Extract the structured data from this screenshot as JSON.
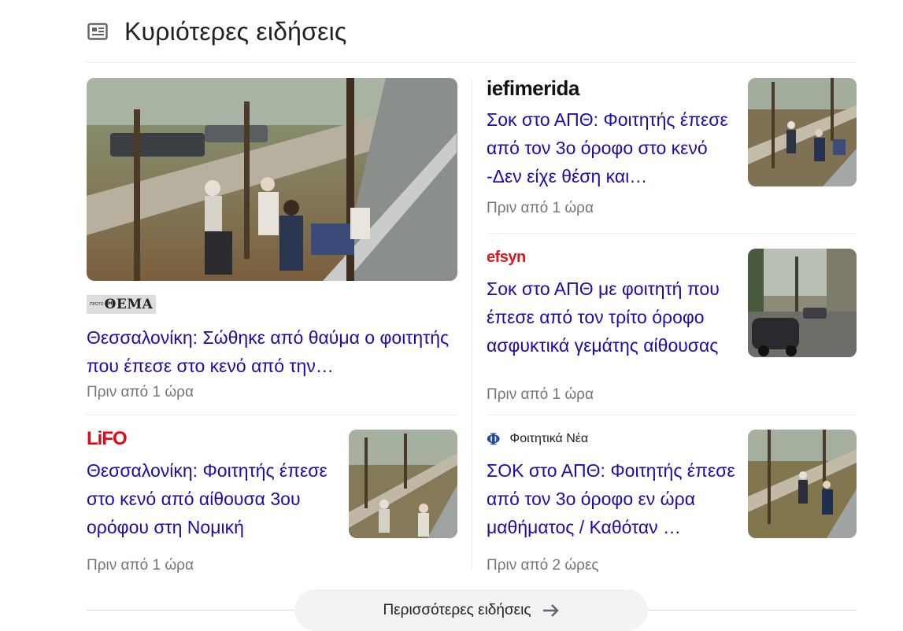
{
  "header": {
    "icon": "newspaper-icon",
    "title": "Κυριότερες ειδήσεις"
  },
  "featured": {
    "source": "ΘΕΜΑ",
    "source_prefix": "ΠΡΩΤΟ",
    "headline": "Θεσσαλονίκη: Σώθηκε από θαύμα ο φοιτητής που έπεσε στο κενό από την…",
    "time": "Πριν από 1 ώρα"
  },
  "articles": [
    {
      "source": "iefimerida",
      "headline": "Σοκ στο ΑΠΘ: Φοιτητής έπεσε από τον 3ο όροφο στο κενό -Δεν είχε θέση και…",
      "time": "Πριν από 1 ώρα"
    },
    {
      "source": "efsyn",
      "headline": "Σοκ στο ΑΠΘ με φοιτητή που έπεσε από τον τρίτο όροφο ασφυκτικά γεμάτης αίθουσας",
      "time": "Πριν από 1 ώρα"
    },
    {
      "source": "LiFO",
      "headline": "Θεσσαλονίκη: Φοιτητής έπεσε στο κενό από αίθουσα 3ου ορόφου στη Νομική",
      "time": "Πριν από 1 ώρα"
    },
    {
      "source": "Φοιτητικά Νέα",
      "source_logo": "Φ",
      "headline": "ΣΟΚ στο ΑΠΘ: Φοιτητής έπεσε από τον 3ο όροφο εν ώρα μαθήματος / Καθόταν …",
      "time": "Πριν από 2 ώρες"
    }
  ],
  "more_button": {
    "label": "Περισσότερες ειδήσεις",
    "icon": "arrow-right-icon"
  },
  "colors": {
    "link": "#1a0dab",
    "meta": "#70757a",
    "iefimerida_red": "#e2001a",
    "efsyn_red": "#d71920",
    "lifo_red": "#e30613"
  }
}
